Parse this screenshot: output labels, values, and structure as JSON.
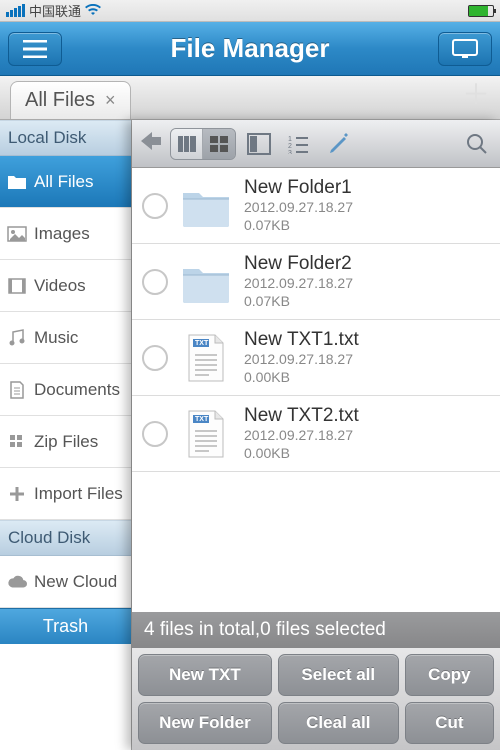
{
  "statusbar": {
    "carrier": "中国联通"
  },
  "header": {
    "title": "File Manager"
  },
  "tab": {
    "label": "All Files"
  },
  "sidebar": {
    "section_local": "Local Disk",
    "section_cloud": "Cloud Disk",
    "items": [
      {
        "label": "All Files"
      },
      {
        "label": "Images"
      },
      {
        "label": "Videos"
      },
      {
        "label": "Music"
      },
      {
        "label": "Documents"
      },
      {
        "label": "Zip Files"
      },
      {
        "label": "Import Files"
      }
    ],
    "cloud_item": "New Cloud",
    "trash": "Trash"
  },
  "files": [
    {
      "name": "New Folder1",
      "date": "2012.09.27.18.27",
      "size": "0.07KB",
      "kind": "folder"
    },
    {
      "name": "New Folder2",
      "date": "2012.09.27.18.27",
      "size": "0.07KB",
      "kind": "folder"
    },
    {
      "name": "New TXT1.txt",
      "date": "2012.09.27.18.27",
      "size": "0.00KB",
      "kind": "txt"
    },
    {
      "name": "New TXT2.txt",
      "date": "2012.09.27.18.27",
      "size": "0.00KB",
      "kind": "txt"
    }
  ],
  "status": "4 files in total,0 files selected",
  "actions": {
    "new_txt": "New TXT",
    "select_all": "Select all",
    "copy": "Copy",
    "new_folder": "New Folder",
    "clear_all": "Cleal all",
    "cut": "Cut"
  }
}
